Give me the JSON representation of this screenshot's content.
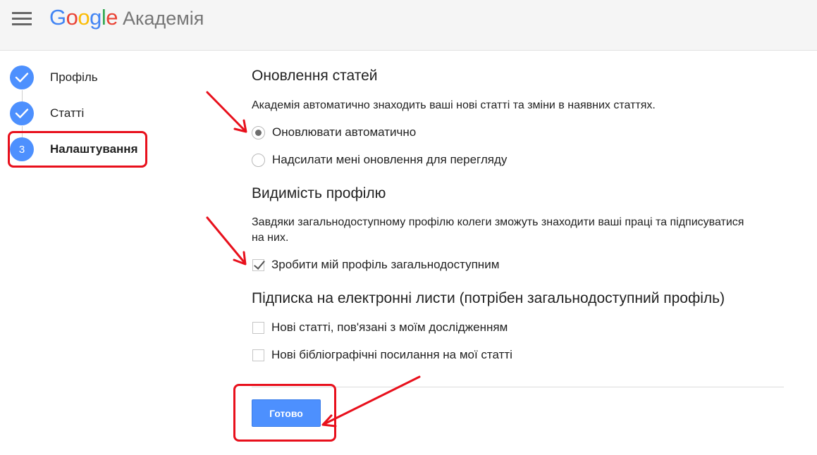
{
  "header": {
    "logo_letters": [
      {
        "char": "G",
        "color": "#4285f4"
      },
      {
        "char": "o",
        "color": "#ea4335"
      },
      {
        "char": "o",
        "color": "#fbbc05"
      },
      {
        "char": "g",
        "color": "#4285f4"
      },
      {
        "char": "l",
        "color": "#34a853"
      },
      {
        "char": "e",
        "color": "#ea4335"
      }
    ],
    "product_name": "Академія",
    "menu_icon": "hamburger-menu-icon"
  },
  "steps": [
    {
      "label": "Профіль",
      "state": "done",
      "icon": "checkmark-icon"
    },
    {
      "label": "Статті",
      "state": "done",
      "icon": "checkmark-icon"
    },
    {
      "label": "Налаштування",
      "state": "active",
      "number": "3"
    }
  ],
  "updates": {
    "title": "Оновлення статей",
    "description": "Академія автоматично знаходить ваші нові статті та зміни в наявних статтях.",
    "options": [
      {
        "label": "Оновлювати автоматично",
        "checked": true
      },
      {
        "label": "Надсилати мені оновлення для перегляду",
        "checked": false
      }
    ]
  },
  "visibility": {
    "title": "Видимість профілю",
    "description": "Завдяки загальнодоступному профілю колеги зможуть знаходити ваші праці та підписуватися на них.",
    "checkbox_label": "Зробити мій профіль загальнодоступним",
    "checked": true
  },
  "email": {
    "title": "Підписка на електронні листи (потрібен загальнодоступний профіль)",
    "options": [
      {
        "label": "Нові статті, пов'язані з моїм дослідженням",
        "checked": false
      },
      {
        "label": "Нові бібліографічні посилання на мої статті",
        "checked": false
      }
    ]
  },
  "done_label": "Готово",
  "colors": {
    "accent": "#4d90fe",
    "annotation": "#e8101c"
  }
}
